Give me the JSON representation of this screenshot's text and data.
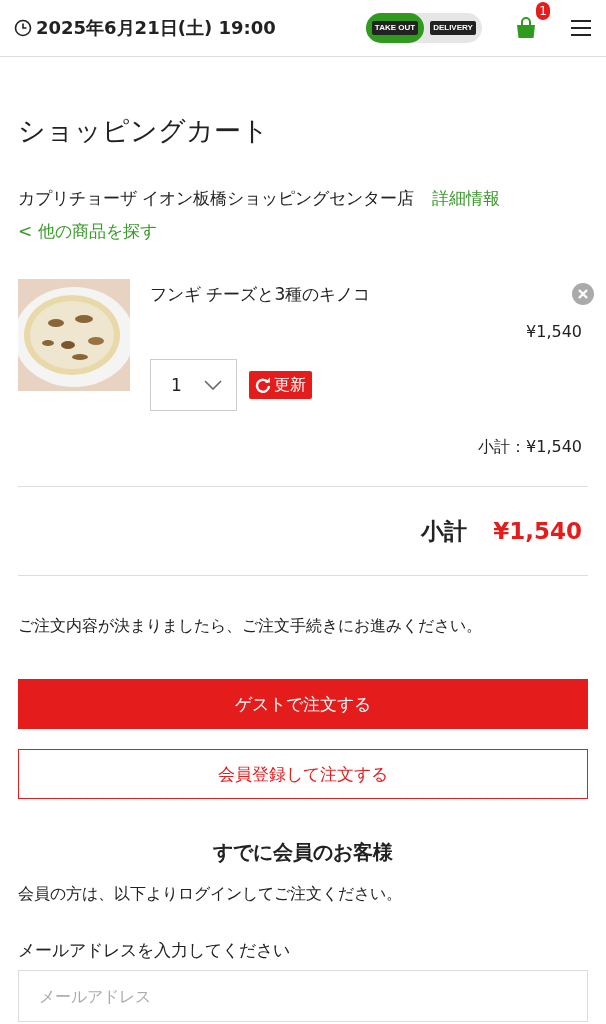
{
  "header": {
    "datetime": "2025年6月21日(土) 19:00",
    "modes": [
      {
        "label": "TAKE OUT",
        "selected": true
      },
      {
        "label": "DELIVERY",
        "selected": false
      }
    ],
    "cart_count": "1"
  },
  "title": "ショッピングカート",
  "store": {
    "name": "カプリチョーザ イオン板橋ショッピングセンター店",
    "details_link": "詳細情報"
  },
  "back_link": "< 他の商品を探す",
  "items": [
    {
      "name": "フンギ チーズと3種のキノコ",
      "price": "¥1,540",
      "quantity": "1",
      "update_label": "更新",
      "subtotal": "小計：¥1,540"
    }
  ],
  "total": {
    "label": "小計",
    "amount": "¥1,540"
  },
  "note": "ご注文内容が決まりましたら、ご注文手続きにお進みください。",
  "buttons": [
    {
      "kind": "primary",
      "label": "ゲストで注文する"
    },
    {
      "kind": "outline",
      "label": "会員登録して注文する"
    }
  ],
  "member": {
    "heading": "すでに会員のお客様",
    "text": "会員の方は、以下よりログインしてご注文ください。",
    "email_label": "メールアドレスを入力してください",
    "email_placeholder": "メールアドレス"
  }
}
